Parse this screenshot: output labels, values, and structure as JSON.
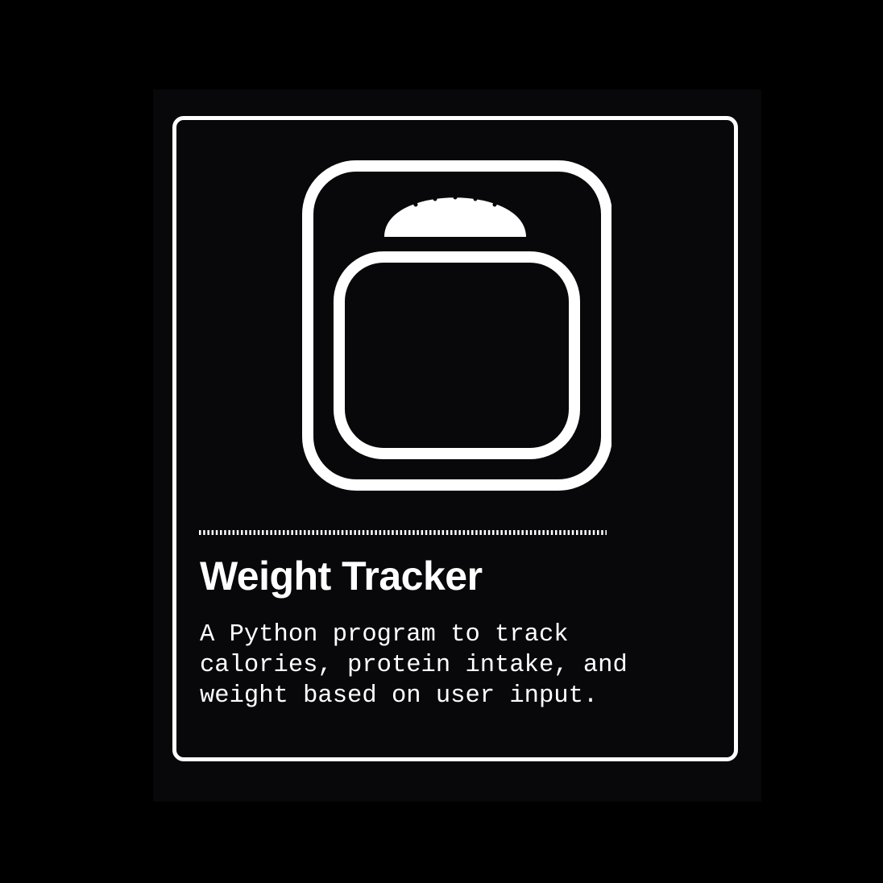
{
  "project": {
    "title": "Weight Tracker",
    "description": "A Python program to track\ncalories, protein intake, and\nweight based on user input."
  },
  "icons": {
    "main": "bathroom-scale-icon",
    "divider": "dotted-divider"
  },
  "colors": {
    "page_background": "#000000",
    "panel_background": "#08080a",
    "foreground": "#ffffff"
  }
}
